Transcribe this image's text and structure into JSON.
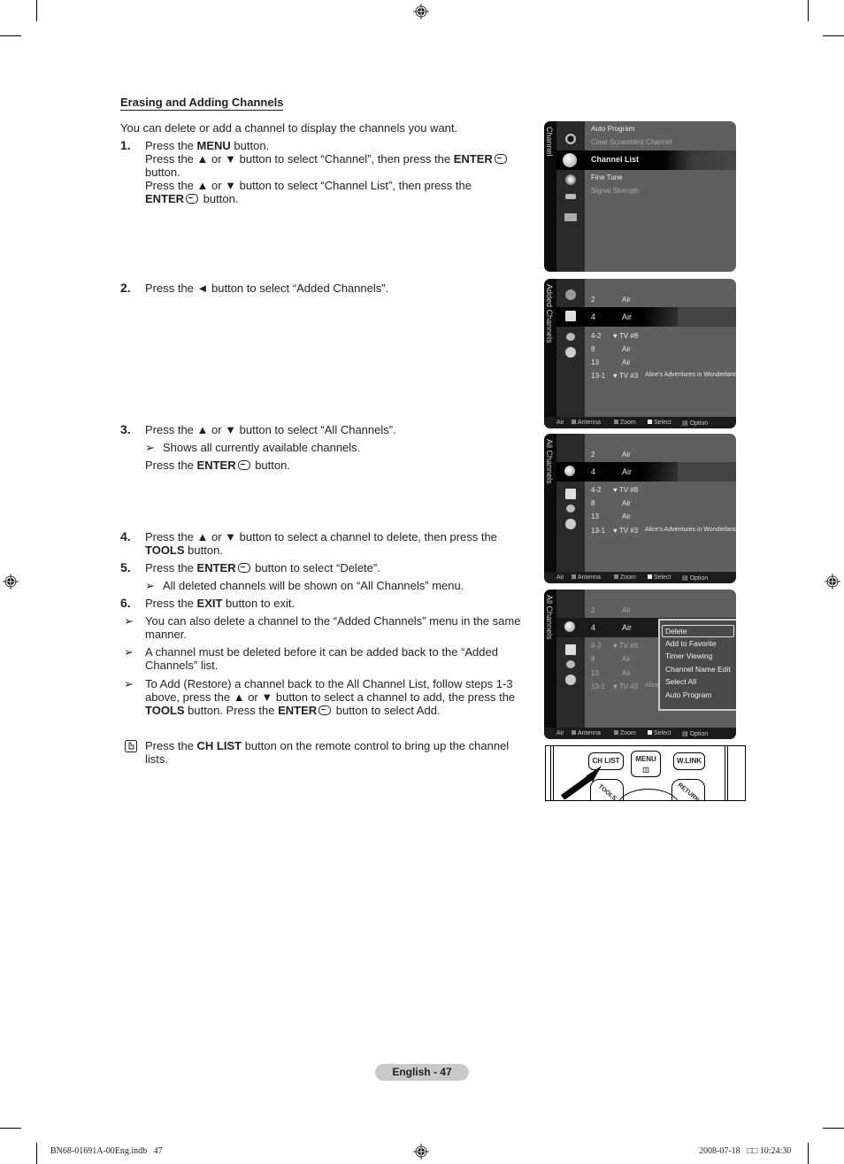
{
  "section_title": "Erasing and Adding Channels",
  "intro": "You can delete or add a channel to display the channels you want.",
  "steps": [
    {
      "num": "1.",
      "lines": [
        {
          "pre": "Press the ",
          "bold": "MENU",
          "post": " button."
        },
        {
          "pre": "Press the ▲ or ▼ button to select “Channel”, then press the ",
          "bold": "ENTER",
          "post": " button."
        },
        {
          "pre": "Press the ▲ or ▼ button to select “Channel List”, then press the ",
          "bold": "ENTER",
          "post": " button."
        }
      ]
    },
    {
      "num": "2.",
      "text": "Press the ◄ button to select “Added Channels”."
    },
    {
      "num": "3.",
      "text": "Press the ▲ or ▼ button to select “All Channels”.",
      "note": "Shows all currently available channels.",
      "line2_pre": "Press the ",
      "line2_bold": "ENTER",
      "line2_post": " button."
    },
    {
      "num": "4.",
      "pre": "Press the ▲ or ▼ button to select a channel to delete, then press the ",
      "bold": "TOOLS",
      "post": " button."
    },
    {
      "num": "5.",
      "pre": "Press the ",
      "bold": "ENTER",
      "post": " button to select “Delete”.",
      "note": "All deleted channels will be shown on “All Channels” menu."
    },
    {
      "num": "6.",
      "pre": "Press the ",
      "bold": "EXIT",
      "post": " button to exit."
    }
  ],
  "notes": [
    "You can also delete a channel to the “Added Channels” menu in the same manner.",
    "A channel must be deleted before it can be added back to the “Added Channels” list."
  ],
  "note3": {
    "a": "To Add (Restore) a channel back to the All Channel List, follow steps 1-3 above, press the ▲ or ▼ button to select a channel to add, the press the ",
    "b1": "TOOLS",
    "c": " button. Press the ",
    "b2": "ENTER",
    "d": " button to select Add."
  },
  "tip": {
    "pre": "Press the ",
    "bold": "CH LIST",
    "post": " button on the remote control to bring up the channel lists."
  },
  "arrow_glyph": "➢",
  "screen1": {
    "side_label": "Channel",
    "items": [
      "Auto Program",
      "Clear Scrambled Channel",
      "Channel List",
      "Fine Tune",
      "Signal Strength"
    ]
  },
  "screen2": {
    "side_label": "Added Channels",
    "channels": [
      {
        "num": "2",
        "name": "Air",
        "prog": ""
      },
      {
        "num": "4",
        "name": "Air",
        "prog": ""
      },
      {
        "num": "4-2",
        "name": "♥ TV #8",
        "prog": ""
      },
      {
        "num": "8",
        "name": "Air",
        "prog": ""
      },
      {
        "num": "13",
        "name": "Air",
        "prog": ""
      },
      {
        "num": "13-1",
        "name": "♥ TV #3",
        "prog": "Alice’s Adventures in Wonderland"
      }
    ],
    "icon_tag": "All"
  },
  "screen3": {
    "side_label": "All Channels",
    "icon_tag": "All"
  },
  "screen4": {
    "side_label": "All Channels",
    "prog_cut": "Alice",
    "popup": [
      "Delete",
      "Add to Favorite",
      "Timer Viewing",
      "Channel Name Edit",
      "Select All",
      "Auto Program"
    ]
  },
  "footer_bar": {
    "source": "Air",
    "antenna": "Antenna",
    "zoom": "Zoom",
    "select": "Select",
    "option": "Option"
  },
  "remote": {
    "ch_list": "CH LIST",
    "menu": "MENU",
    "wlink": "W.LINK",
    "tools": "TOOLS",
    "return": "RETURN"
  },
  "page_label": "English - 47",
  "slug_left": "BN68-01691A-00Eng.indb   47",
  "slug_right": "2008-07-18   □□ 10:24:30"
}
